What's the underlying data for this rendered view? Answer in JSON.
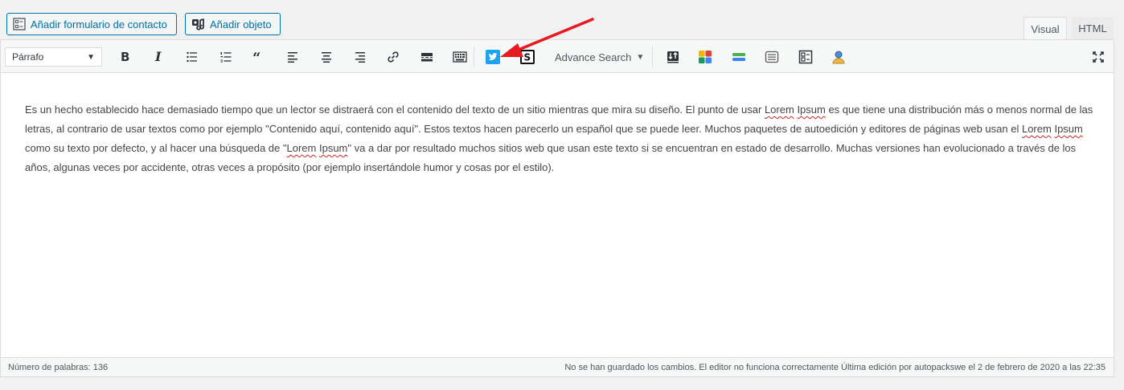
{
  "media_buttons": {
    "contact_form_label": "Añadir formulario de contacto",
    "add_object_label": "Añadir objeto"
  },
  "tabs": {
    "visual": "Visual",
    "html": "HTML"
  },
  "toolbar": {
    "format_select_value": "Párrafo",
    "advance_search_label": "Advance Search",
    "icons": [
      "bold-icon",
      "italic-icon",
      "bullet-list-icon",
      "numbered-list-icon",
      "blockquote-icon",
      "align-left-icon",
      "align-center-icon",
      "align-right-icon",
      "link-icon",
      "read-more-icon",
      "toolbar-toggle-icon",
      "twitter-icon",
      "shortcode-icon",
      "advance-search-icon",
      "upload-icon",
      "color-grid-icon",
      "divider-icon",
      "list-box-icon",
      "layout-icon",
      "user-icon",
      "fullscreen-icon"
    ]
  },
  "content": {
    "p1_a": "Es un hecho establecido hace demasiado tiempo que un lector se distraerá con el contenido del texto de un sitio mientras que mira su diseño. El punto de usar ",
    "lorem1": "Lorem",
    "ipsum1": "Ipsum",
    "p1_b": " es que tiene una distribución más o menos normal de las letras, al contrario de usar textos como por ejemplo \"Contenido aquí, contenido aquí\". Estos textos hacen parecerlo un español que se puede leer. Muchos paquetes de autoedición y editores de páginas web usan el ",
    "lorem2": "Lorem",
    "ipsum2": "Ipsum",
    "p1_c": " como su texto por defecto, y al hacer una búsqueda de \"",
    "lorem3": "Lorem",
    "ipsum3": "Ipsum",
    "p1_d": "\" va a dar por resultado muchos sitios web que usan este texto si se encuentran en estado de desarrollo. Muchas versiones han evolucionado a través de los años, algunas veces por accidente, otras veces a propósito (por ejemplo insertándole humor y cosas por el estilo)."
  },
  "status": {
    "word_count": "Número de palabras: 136",
    "save_status": "No se han guardado los cambios. El editor no funciona correctamente Última edición por autopackswe el 2 de febrero de 2020 a las 22:35"
  },
  "colors": {
    "accent": "#0071a1",
    "annotation": "#e8191f",
    "twitter": "#1da1f2"
  }
}
